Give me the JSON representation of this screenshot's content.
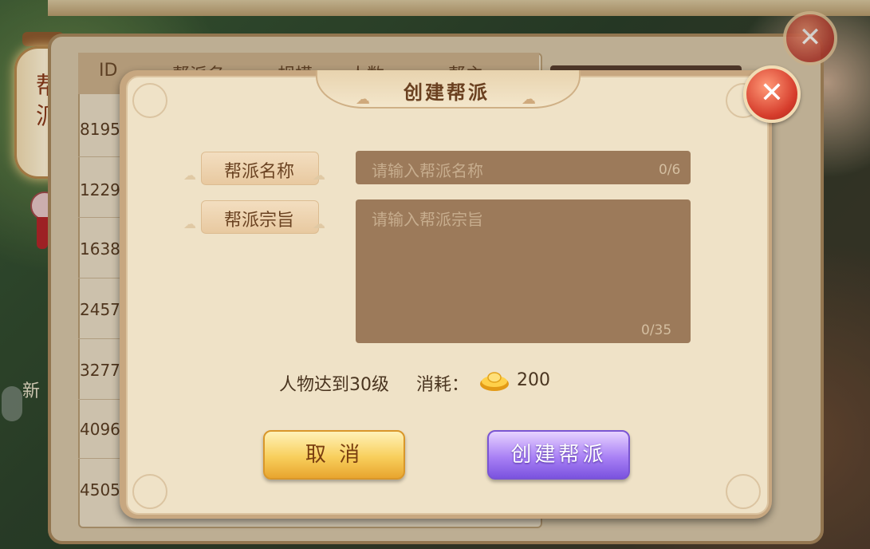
{
  "background": {
    "lantern_text": "帮派",
    "side_text": "新",
    "table": {
      "columns": [
        "ID",
        "帮派名",
        "规模",
        "人数",
        "帮主"
      ],
      "ids": [
        "8195",
        "1229",
        "1638",
        "2457",
        "3277",
        "4096",
        "4505"
      ]
    }
  },
  "dialog": {
    "title": "创建帮派",
    "close_icon": "close-icon",
    "name_field": {
      "label": "帮派名称",
      "placeholder": "请输入帮派名称",
      "counter": "0/6"
    },
    "motto_field": {
      "label": "帮派宗旨",
      "placeholder": "请输入帮派宗旨",
      "counter": "0/35"
    },
    "requirement": "人物达到30级",
    "cost_label": "消耗：",
    "cost_icon": "gold-ingot-icon",
    "cost_value": "200",
    "cancel_label": "取 消",
    "create_label": "创建帮派"
  },
  "colors": {
    "dialog_bg": "#efe2c7",
    "input_bg": "#9c7a5a",
    "cancel_button": "#f8cf5c",
    "create_button": "#a981f5",
    "close_button": "#d63d2c"
  }
}
